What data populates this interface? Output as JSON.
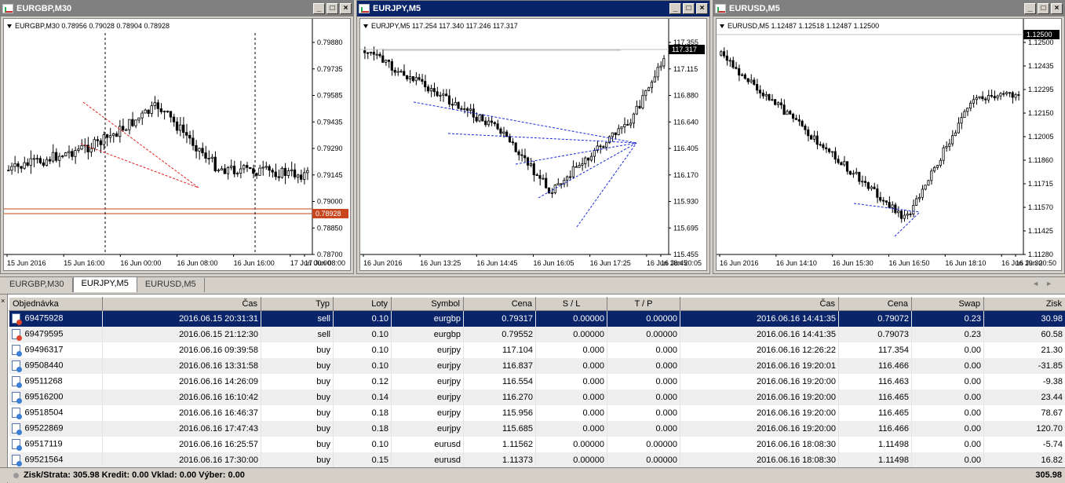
{
  "windows": [
    {
      "title": "EURGBP,M30",
      "active": false,
      "ohlc": "EURGBP,M30  0.78956 0.79028 0.78904 0.78928",
      "price_labels": [
        "0.79880",
        "0.79735",
        "0.79585",
        "0.79435",
        "0.79290",
        "0.79145",
        "0.79000",
        "0.78850",
        "0.78700"
      ],
      "current_price": "0.78928",
      "time_labels": [
        "15 Jun 2016",
        "15 Jun 16:00",
        "16 Jun 00:00",
        "16 Jun 08:00",
        "16 Jun 16:00",
        "17 Jun 00:00",
        "17 Jun 08:00"
      ],
      "accent": "#c8451e"
    },
    {
      "title": "EURJPY,M5",
      "active": true,
      "ohlc": "EURJPY,M5  117.254 117.340 117.246 117.317",
      "price_labels": [
        "117.355",
        "117.115",
        "116.880",
        "116.640",
        "116.405",
        "116.170",
        "115.930",
        "115.695",
        "115.455"
      ],
      "current_price": "117.317",
      "time_labels": [
        "16 Jun 2016",
        "16 Jun 13:25",
        "16 Jun 14:45",
        "16 Jun 16:05",
        "16 Jun 17:25",
        "16 Jun 18:45",
        "16 Jun 20:05"
      ],
      "accent": "#000000"
    },
    {
      "title": "EURUSD,M5",
      "active": false,
      "ohlc": "EURUSD,M5  1.12487 1.12518 1.12487 1.12500",
      "price_labels": [
        "1.12500",
        "1.12435",
        "1.12295",
        "1.12150",
        "1.12005",
        "1.11860",
        "1.11715",
        "1.11570",
        "1.11425",
        "1.11280"
      ],
      "current_price": "1.12500",
      "time_labels": [
        "16 Jun 2016",
        "16 Jun 14:10",
        "16 Jun 15:30",
        "16 Jun 16:50",
        "16 Jun 18:10",
        "16 Jun 19:30",
        "16 Jun 20:50"
      ],
      "accent": "#000000"
    }
  ],
  "tabs": [
    "EURGBP,M30",
    "EURJPY,M5",
    "EURUSD,M5"
  ],
  "active_tab": 1,
  "table": {
    "headers": [
      "Objednávka",
      "Čas",
      "Typ",
      "Loty",
      "Symbol",
      "Cena",
      "S / L",
      "T / P",
      "Čas",
      "Cena",
      "Swap",
      "Zisk"
    ],
    "rows": [
      [
        "69475928",
        "2016.06.15 20:31:31",
        "sell",
        "0.10",
        "eurgbp",
        "0.79317",
        "0.00000",
        "0.00000",
        "2016.06.16 14:41:35",
        "0.79072",
        "0.23",
        "30.98"
      ],
      [
        "69479595",
        "2016.06.15 21:12:30",
        "sell",
        "0.10",
        "eurgbp",
        "0.79552",
        "0.00000",
        "0.00000",
        "2016.06.16 14:41:35",
        "0.79073",
        "0.23",
        "60.58"
      ],
      [
        "69496317",
        "2016.06.16 09:39:58",
        "buy",
        "0.10",
        "eurjpy",
        "117.104",
        "0.000",
        "0.000",
        "2016.06.16 12:26:22",
        "117.354",
        "0.00",
        "21.30"
      ],
      [
        "69508440",
        "2016.06.16 13:31:58",
        "buy",
        "0.10",
        "eurjpy",
        "116.837",
        "0.000",
        "0.000",
        "2016.06.16 19:20:01",
        "116.466",
        "0.00",
        "-31.85"
      ],
      [
        "69511268",
        "2016.06.16 14:26:09",
        "buy",
        "0.12",
        "eurjpy",
        "116.554",
        "0.000",
        "0.000",
        "2016.06.16 19:20:00",
        "116.463",
        "0.00",
        "-9.38"
      ],
      [
        "69516200",
        "2016.06.16 16:10:42",
        "buy",
        "0.14",
        "eurjpy",
        "116.270",
        "0.000",
        "0.000",
        "2016.06.16 19:20:00",
        "116.465",
        "0.00",
        "23.44"
      ],
      [
        "69518504",
        "2016.06.16 16:46:37",
        "buy",
        "0.18",
        "eurjpy",
        "115.956",
        "0.000",
        "0.000",
        "2016.06.16 19:20:00",
        "116.465",
        "0.00",
        "78.67"
      ],
      [
        "69522869",
        "2016.06.16 17:47:43",
        "buy",
        "0.18",
        "eurjpy",
        "115.685",
        "0.000",
        "0.000",
        "2016.06.16 19:20:00",
        "116.466",
        "0.00",
        "120.70"
      ],
      [
        "69517119",
        "2016.06.16 16:25:57",
        "buy",
        "0.10",
        "eurusd",
        "1.11562",
        "0.00000",
        "0.00000",
        "2016.06.16 18:08:30",
        "1.11498",
        "0.00",
        "-5.74"
      ],
      [
        "69521564",
        "2016.06.16 17:30:00",
        "buy",
        "0.15",
        "eurusd",
        "1.11373",
        "0.00000",
        "0.00000",
        "2016.06.16 18:08:30",
        "1.11498",
        "0.00",
        "16.82"
      ]
    ]
  },
  "summary": {
    "text": "Zisk/Strata: 305.98  Kredit: 0.00  Vklad: 0.00  Výber: 0.00",
    "total": "305.98"
  },
  "colors": {
    "selection": "#0a246a",
    "active_title": "#0a246a",
    "inactive_title": "#808080",
    "trade_line_red": "#e02020",
    "trade_line_blue": "#1a2ad8"
  }
}
